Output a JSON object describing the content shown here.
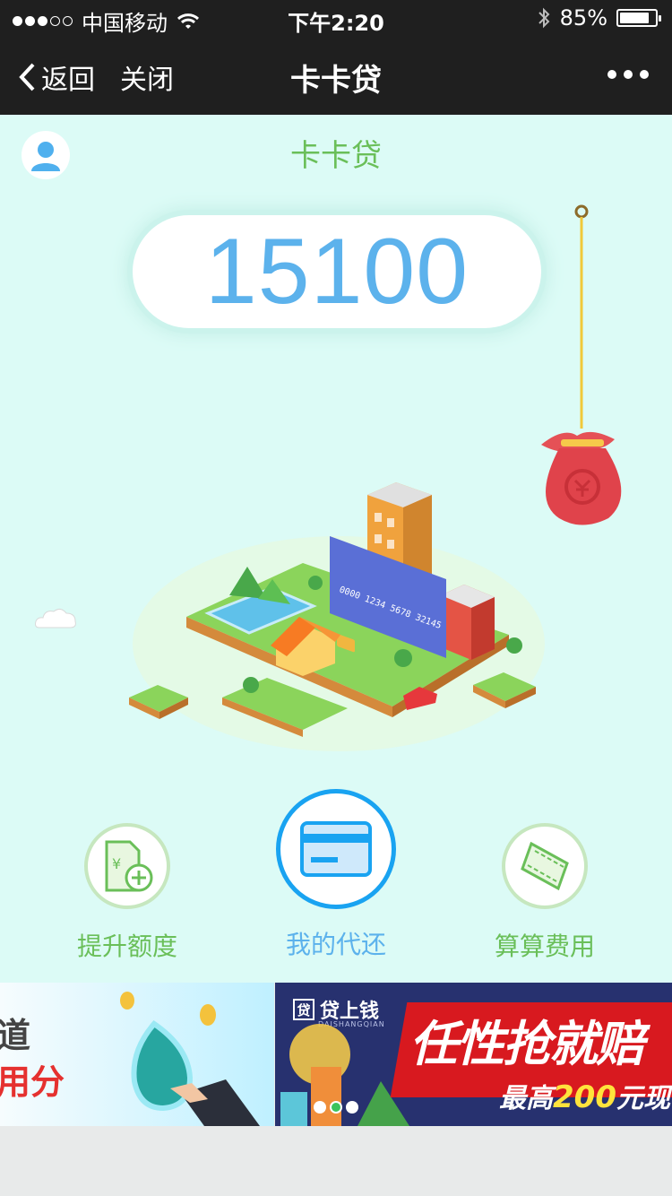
{
  "status_bar": {
    "carrier": "中国移动",
    "time": "下午2:20",
    "battery": "85%",
    "battery_level": 0.85
  },
  "nav": {
    "back_label": "返回",
    "close_label": "关闭",
    "title": "卡卡贷"
  },
  "main": {
    "app_title": "卡卡贷",
    "amount": "15100",
    "card_number": "0000 1234 5678 32145",
    "actions": [
      {
        "label": "提升额度",
        "icon": "raise-limit-icon"
      },
      {
        "label": "我的代还",
        "icon": "card-icon"
      },
      {
        "label": "算算费用",
        "icon": "calculator-icon"
      }
    ]
  },
  "banner": {
    "left_line1": "道",
    "left_line2": "用分",
    "brand_name": "贷上钱",
    "brand_char": "贷",
    "brand_sub": "DAISHANGQIAN",
    "slogan": "任性抢就赔",
    "highest_prefix": "最高",
    "highest_amount": "200",
    "highest_suffix": "元现"
  },
  "colors": {
    "bar_bg": "#1f1f1f",
    "page_bg": "#dcfbf6",
    "accent_blue": "#5cb2ec",
    "accent_green": "#6abf59",
    "active_ring": "#19a3f1"
  }
}
